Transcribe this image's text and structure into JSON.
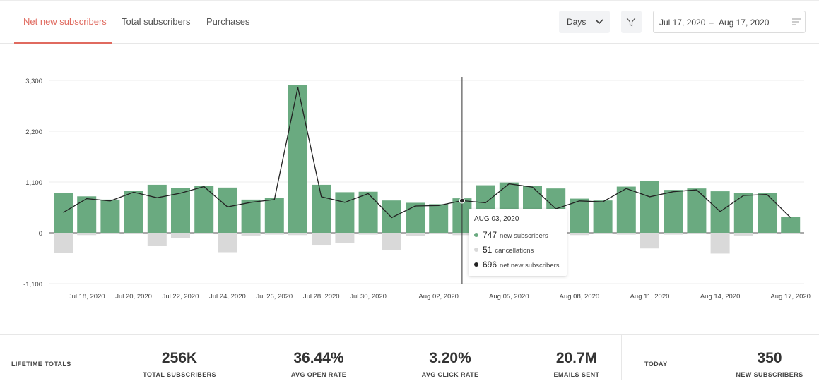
{
  "tabs": [
    {
      "label": "Net new subscribers",
      "active": true
    },
    {
      "label": "Total subscribers",
      "active": false
    },
    {
      "label": "Purchases",
      "active": false
    }
  ],
  "controls": {
    "granularity": "Days",
    "date_start": "Jul 17, 2020",
    "date_separator": "–",
    "date_end": "Aug 17, 2020"
  },
  "colors": {
    "accent": "#e06a5f",
    "positive_bar": "#6aaa80",
    "negative_bar": "#d9d9d9",
    "line": "#333333"
  },
  "chart_data": {
    "type": "bar",
    "y_ticks": [
      "3,300",
      "2,200",
      "1,100",
      "0",
      "-1,100"
    ],
    "ylim": [
      -1100,
      3300
    ],
    "x_tick_labels": [
      "Jul 18, 2020",
      "Jul 20, 2020",
      "Jul 22, 2020",
      "Jul 24, 2020",
      "Jul 26, 2020",
      "Jul 28, 2020",
      "Jul 30, 2020",
      "Aug 02, 2020",
      "Aug 05, 2020",
      "Aug 08, 2020",
      "Aug 11, 2020",
      "Aug 14, 2020",
      "Aug 17, 2020"
    ],
    "x_tick_days": [
      1,
      3,
      5,
      7,
      9,
      11,
      13,
      16,
      19,
      22,
      25,
      28,
      31
    ],
    "days": [
      "Jul 17, 2020",
      "Jul 18, 2020",
      "Jul 19, 2020",
      "Jul 20, 2020",
      "Jul 21, 2020",
      "Jul 22, 2020",
      "Jul 23, 2020",
      "Jul 24, 2020",
      "Jul 25, 2020",
      "Jul 26, 2020",
      "Jul 27, 2020",
      "Jul 28, 2020",
      "Jul 29, 2020",
      "Jul 30, 2020",
      "Jul 31, 2020",
      "Aug 01, 2020",
      "Aug 02, 2020",
      "Aug 03, 2020",
      "Aug 04, 2020",
      "Aug 05, 2020",
      "Aug 06, 2020",
      "Aug 07, 2020",
      "Aug 08, 2020",
      "Aug 09, 2020",
      "Aug 10, 2020",
      "Aug 11, 2020",
      "Aug 12, 2020",
      "Aug 13, 2020",
      "Aug 14, 2020",
      "Aug 15, 2020",
      "Aug 16, 2020",
      "Aug 17, 2020"
    ],
    "series": [
      {
        "name": "new subscribers",
        "values": [
          870,
          790,
          720,
          910,
          1040,
          970,
          1020,
          980,
          720,
          760,
          3200,
          1040,
          880,
          890,
          700,
          650,
          620,
          747,
          1030,
          1090,
          1020,
          960,
          740,
          700,
          1000,
          1120,
          930,
          960,
          900,
          870,
          860,
          350
        ]
      },
      {
        "name": "cancellations",
        "values": [
          430,
          50,
          30,
          30,
          280,
          110,
          20,
          420,
          60,
          40,
          50,
          260,
          220,
          40,
          380,
          70,
          30,
          51,
          40,
          30,
          30,
          40,
          50,
          30,
          40,
          340,
          40,
          30,
          450,
          60,
          30,
          20
        ]
      },
      {
        "name": "net new subscribers",
        "values": [
          440,
          740,
          690,
          880,
          760,
          860,
          1000,
          560,
          660,
          720,
          3150,
          780,
          660,
          850,
          330,
          580,
          590,
          696,
          650,
          1060,
          990,
          520,
          690,
          670,
          960,
          780,
          890,
          930,
          460,
          810,
          830,
          330
        ]
      }
    ],
    "highlight": {
      "index": 17,
      "date": "AUG 03, 2020"
    }
  },
  "tooltip": {
    "date": "AUG 03, 2020",
    "rows": [
      {
        "value": "747",
        "label": "new subscribers",
        "color": "#6aaa80"
      },
      {
        "value": "51",
        "label": "cancellations",
        "color": "#d9d9d9"
      },
      {
        "value": "696",
        "label": "net new subscribers",
        "color": "#222222"
      }
    ]
  },
  "footer": {
    "lifetime_label": "LIFETIME TOTALS",
    "stats": [
      {
        "value": "256K",
        "label": "TOTAL SUBSCRIBERS"
      },
      {
        "value": "36.44%",
        "label": "AVG OPEN RATE"
      },
      {
        "value": "3.20%",
        "label": "AVG CLICK RATE"
      },
      {
        "value": "20.7M",
        "label": "EMAILS SENT"
      }
    ],
    "today_label": "TODAY",
    "today_stat": {
      "value": "350",
      "label": "NEW SUBSCRIBERS"
    }
  }
}
